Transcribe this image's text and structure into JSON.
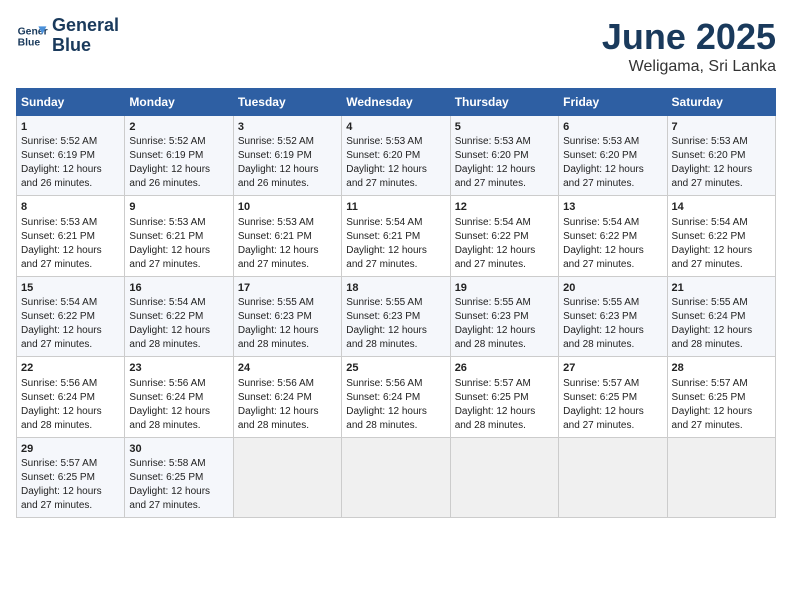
{
  "logo": {
    "line1": "General",
    "line2": "Blue"
  },
  "title": "June 2025",
  "subtitle": "Weligama, Sri Lanka",
  "days_header": [
    "Sunday",
    "Monday",
    "Tuesday",
    "Wednesday",
    "Thursday",
    "Friday",
    "Saturday"
  ],
  "weeks": [
    [
      {
        "day": "1",
        "text": "Sunrise: 5:52 AM\nSunset: 6:19 PM\nDaylight: 12 hours\nand 26 minutes."
      },
      {
        "day": "2",
        "text": "Sunrise: 5:52 AM\nSunset: 6:19 PM\nDaylight: 12 hours\nand 26 minutes."
      },
      {
        "day": "3",
        "text": "Sunrise: 5:52 AM\nSunset: 6:19 PM\nDaylight: 12 hours\nand 26 minutes."
      },
      {
        "day": "4",
        "text": "Sunrise: 5:53 AM\nSunset: 6:20 PM\nDaylight: 12 hours\nand 27 minutes."
      },
      {
        "day": "5",
        "text": "Sunrise: 5:53 AM\nSunset: 6:20 PM\nDaylight: 12 hours\nand 27 minutes."
      },
      {
        "day": "6",
        "text": "Sunrise: 5:53 AM\nSunset: 6:20 PM\nDaylight: 12 hours\nand 27 minutes."
      },
      {
        "day": "7",
        "text": "Sunrise: 5:53 AM\nSunset: 6:20 PM\nDaylight: 12 hours\nand 27 minutes."
      }
    ],
    [
      {
        "day": "8",
        "text": "Sunrise: 5:53 AM\nSunset: 6:21 PM\nDaylight: 12 hours\nand 27 minutes."
      },
      {
        "day": "9",
        "text": "Sunrise: 5:53 AM\nSunset: 6:21 PM\nDaylight: 12 hours\nand 27 minutes."
      },
      {
        "day": "10",
        "text": "Sunrise: 5:53 AM\nSunset: 6:21 PM\nDaylight: 12 hours\nand 27 minutes."
      },
      {
        "day": "11",
        "text": "Sunrise: 5:54 AM\nSunset: 6:21 PM\nDaylight: 12 hours\nand 27 minutes."
      },
      {
        "day": "12",
        "text": "Sunrise: 5:54 AM\nSunset: 6:22 PM\nDaylight: 12 hours\nand 27 minutes."
      },
      {
        "day": "13",
        "text": "Sunrise: 5:54 AM\nSunset: 6:22 PM\nDaylight: 12 hours\nand 27 minutes."
      },
      {
        "day": "14",
        "text": "Sunrise: 5:54 AM\nSunset: 6:22 PM\nDaylight: 12 hours\nand 27 minutes."
      }
    ],
    [
      {
        "day": "15",
        "text": "Sunrise: 5:54 AM\nSunset: 6:22 PM\nDaylight: 12 hours\nand 27 minutes."
      },
      {
        "day": "16",
        "text": "Sunrise: 5:54 AM\nSunset: 6:22 PM\nDaylight: 12 hours\nand 28 minutes."
      },
      {
        "day": "17",
        "text": "Sunrise: 5:55 AM\nSunset: 6:23 PM\nDaylight: 12 hours\nand 28 minutes."
      },
      {
        "day": "18",
        "text": "Sunrise: 5:55 AM\nSunset: 6:23 PM\nDaylight: 12 hours\nand 28 minutes."
      },
      {
        "day": "19",
        "text": "Sunrise: 5:55 AM\nSunset: 6:23 PM\nDaylight: 12 hours\nand 28 minutes."
      },
      {
        "day": "20",
        "text": "Sunrise: 5:55 AM\nSunset: 6:23 PM\nDaylight: 12 hours\nand 28 minutes."
      },
      {
        "day": "21",
        "text": "Sunrise: 5:55 AM\nSunset: 6:24 PM\nDaylight: 12 hours\nand 28 minutes."
      }
    ],
    [
      {
        "day": "22",
        "text": "Sunrise: 5:56 AM\nSunset: 6:24 PM\nDaylight: 12 hours\nand 28 minutes."
      },
      {
        "day": "23",
        "text": "Sunrise: 5:56 AM\nSunset: 6:24 PM\nDaylight: 12 hours\nand 28 minutes."
      },
      {
        "day": "24",
        "text": "Sunrise: 5:56 AM\nSunset: 6:24 PM\nDaylight: 12 hours\nand 28 minutes."
      },
      {
        "day": "25",
        "text": "Sunrise: 5:56 AM\nSunset: 6:24 PM\nDaylight: 12 hours\nand 28 minutes."
      },
      {
        "day": "26",
        "text": "Sunrise: 5:57 AM\nSunset: 6:25 PM\nDaylight: 12 hours\nand 28 minutes."
      },
      {
        "day": "27",
        "text": "Sunrise: 5:57 AM\nSunset: 6:25 PM\nDaylight: 12 hours\nand 27 minutes."
      },
      {
        "day": "28",
        "text": "Sunrise: 5:57 AM\nSunset: 6:25 PM\nDaylight: 12 hours\nand 27 minutes."
      }
    ],
    [
      {
        "day": "29",
        "text": "Sunrise: 5:57 AM\nSunset: 6:25 PM\nDaylight: 12 hours\nand 27 minutes."
      },
      {
        "day": "30",
        "text": "Sunrise: 5:58 AM\nSunset: 6:25 PM\nDaylight: 12 hours\nand 27 minutes."
      },
      {
        "day": "",
        "text": ""
      },
      {
        "day": "",
        "text": ""
      },
      {
        "day": "",
        "text": ""
      },
      {
        "day": "",
        "text": ""
      },
      {
        "day": "",
        "text": ""
      }
    ]
  ]
}
